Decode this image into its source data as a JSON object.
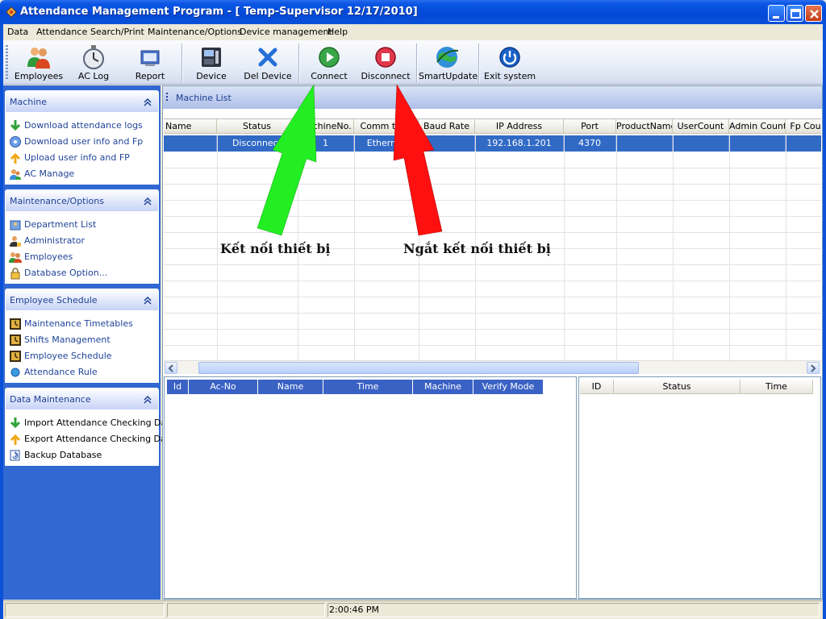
{
  "window": {
    "title": "Attendance Management Program - [ Temp-Supervisor 12/17/2010]"
  },
  "menu": [
    "Data",
    "Attendance",
    "Search/Print",
    "Maintenance/Options",
    "Device management",
    "Help"
  ],
  "toolbar": {
    "employees": "Employees",
    "ac_log": "AC Log",
    "report": "Report",
    "device": "Device",
    "del_device": "Del Device",
    "connect": "Connect",
    "disconnect": "Disconnect",
    "smart_update": "SmartUpdate",
    "exit_system": "Exit system"
  },
  "sidebar": {
    "sections": [
      {
        "title": "Machine",
        "items": [
          "Download attendance logs",
          "Download user info and Fp",
          "Upload user info and FP",
          "AC Manage"
        ]
      },
      {
        "title": "Maintenance/Options",
        "items": [
          "Department List",
          "Administrator",
          "Employees",
          "Database Option..."
        ]
      },
      {
        "title": "Employee Schedule",
        "items": [
          "Maintenance Timetables",
          "Shifts Management",
          "Employee Schedule",
          "Attendance Rule"
        ]
      },
      {
        "title": "Data Maintenance",
        "items": [
          "Import Attendance Checking Data",
          "Export Attendance Checking Data",
          "Backup Database"
        ]
      }
    ]
  },
  "machine_list": {
    "title": "Machine List",
    "columns": [
      "Name",
      "Status",
      "MachineNo.",
      "Comm type",
      "Baud Rate",
      "IP Address",
      "Port",
      "ProductName",
      "UserCount",
      "Admin Count",
      "Fp Cou"
    ],
    "rows": [
      [
        "",
        "Disconnect",
        "1",
        "Ethernet",
        "",
        "192.168.1.201",
        "4370",
        "",
        "",
        "",
        ""
      ]
    ]
  },
  "log_table": {
    "columns": [
      "Id",
      "Ac-No",
      "Name",
      "Time",
      "Machine",
      "Verify Mode"
    ]
  },
  "status_table": {
    "columns": [
      "ID",
      "Status",
      "Time"
    ]
  },
  "annotations": {
    "connect_note": "Kết nối thiết bị",
    "disconnect_note": "Ngắt kết nối thiết bị"
  },
  "statusbar": {
    "time": "2:00:46 PM"
  },
  "colors": {
    "title_blue": "#0a51d8",
    "selection": "#316ac5",
    "arrow_green": "#22ee22",
    "arrow_red": "#ff1010"
  }
}
